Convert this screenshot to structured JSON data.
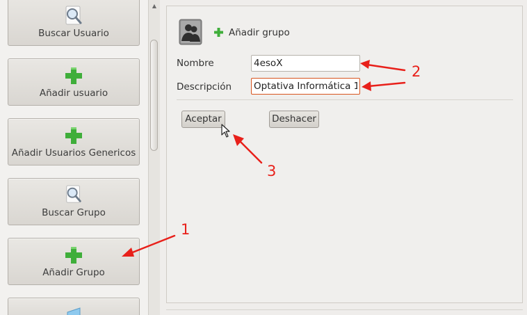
{
  "sidebar": {
    "items": [
      {
        "label": "Buscar Usuario",
        "icon": "magnifier-icon"
      },
      {
        "label": "Añadir usuario",
        "icon": "green-plus-icon"
      },
      {
        "label": "Añadir Usuarios Genericos",
        "icon": "green-plus-icon"
      },
      {
        "label": "Buscar Grupo",
        "icon": "magnifier-icon"
      },
      {
        "label": "Añadir Grupo",
        "icon": "green-plus-icon"
      },
      {
        "label": "",
        "icon": "monitor-icon"
      }
    ]
  },
  "form": {
    "header_title": "Añadir grupo",
    "header_icon": "group-avatar-icon",
    "fields": {
      "nombre_label": "Nombre",
      "nombre_value": "4esoX",
      "descripcion_label": "Descripción",
      "descripcion_value": "Optativa Informática 1"
    },
    "buttons": {
      "accept": "Aceptar",
      "undo": "Deshacer"
    }
  },
  "annotations": {
    "numbers": [
      "1",
      "2",
      "3"
    ],
    "color": "#e8201a"
  },
  "colors": {
    "plus_green": "#3fae3a",
    "focus_border": "#d8541e"
  }
}
